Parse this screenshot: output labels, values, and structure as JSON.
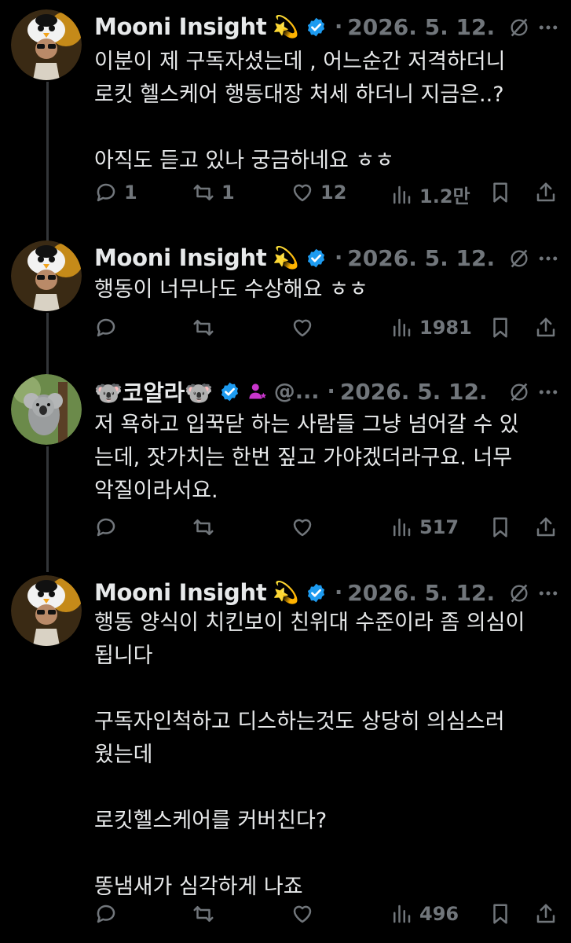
{
  "tweets": [
    {
      "author": "Mooni Insight",
      "emoji": "💫",
      "date": "2026. 5. 12.",
      "text": "이분이 제 구독자셨는데 , 어느순간 저격하더니\n로킷 헬스케어 행동대장 처세 하더니 지금은..?\n\n아직도 듣고 있나 궁금하네요 ㅎㅎ",
      "replies": "1",
      "retweets": "1",
      "likes": "12",
      "views": "1.2만"
    },
    {
      "author": "Mooni Insight",
      "emoji": "💫",
      "date": "2026. 5. 12.",
      "text": "행동이 너무나도 수상해요 ㅎㅎ",
      "replies": "",
      "retweets": "",
      "likes": "",
      "views": "1981"
    },
    {
      "author": "🐨코알라🐨",
      "handle": "@...",
      "date": "2026. 5. 12.",
      "text": "저 욕하고 입꾹닫 하는 사람들 그냥 넘어갈 수 있\n는데, 잣가치는 한번 짚고 가야겠더라구요. 너무\n악질이라서요.",
      "replies": "",
      "retweets": "",
      "likes": "",
      "views": "517"
    },
    {
      "author": "Mooni Insight",
      "emoji": "💫",
      "date": "2026. 5. 12.",
      "text": "행동 양식이 치킨보이 친위대 수준이라 좀 의심이\n됩니다\n\n구독자인척하고 디스하는것도 상당히 의심스러\n웠는데\n\n로킷헬스케어를 커버친다?\n\n똥냄새가 심각하게 나죠",
      "replies": "",
      "retweets": "",
      "likes": "",
      "views": "496"
    }
  ],
  "icons": {
    "verified_color": "#1d9bf0",
    "subscriber_badge_color": "#c936cc",
    "meta_color": "#71767b",
    "thread_line_color": "#333639"
  }
}
